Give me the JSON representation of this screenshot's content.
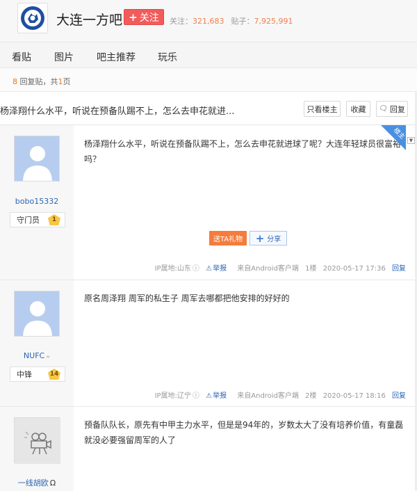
{
  "forum": {
    "name": "大连一方吧",
    "follow_label": "关注",
    "follow_plus": "+",
    "followers_label": "关注：",
    "followers": "321,683",
    "posts_label": "贴子：",
    "posts": "7,925,991"
  },
  "nav": {
    "items": [
      {
        "label": "看贴"
      },
      {
        "label": "图片"
      },
      {
        "label": "吧主推荐"
      },
      {
        "label": "玩乐"
      }
    ]
  },
  "pager": {
    "count": "8",
    "text_replies": "回复贴，共",
    "pages": "1",
    "text_page": "页"
  },
  "thread": {
    "title": "杨泽翔什么水平，听说在预备队踢不上，怎么去申花就进...",
    "only_op_label": "只看楼主",
    "collect_label": "收藏",
    "reply_label": "回复"
  },
  "posts": [
    {
      "username": "bobo15332",
      "badge": "守门员",
      "level": "1",
      "op_tag": "楼主",
      "content": "杨泽翔什么水平，听说在预备队踢不上，怎么去申花就进球了呢？大连年轻球员很富裕吗？",
      "gift_label": "送TA礼物",
      "share_label": "分享",
      "ip": "IP属地:山东",
      "report": "举报",
      "client": "来自Android客户端",
      "floor": "1楼",
      "time": "2020-05-17 17:36",
      "reply": "回复"
    },
    {
      "username": "NUFC",
      "badge": "中锋",
      "level": "14",
      "content": "原名周泽翔 周军的私生子 周军去哪都把他安排的好好的",
      "ip": "IP属地:辽宁",
      "report": "举报",
      "client": "来自Android客户端",
      "floor": "2楼",
      "time": "2020-05-17 18:16",
      "reply": "回复"
    },
    {
      "username": "一线胡欧",
      "content": "预备队队长，原先有中甲主力水平，但是是94年的，岁数太大了没有培养价值，有童磊就没必要强留周军的人了"
    }
  ],
  "colors": {
    "accent_red": "#f35a5a",
    "link_blue": "#2d64b3",
    "orange": "#f47c3c",
    "op_tag_blue": "#4a90e2"
  }
}
